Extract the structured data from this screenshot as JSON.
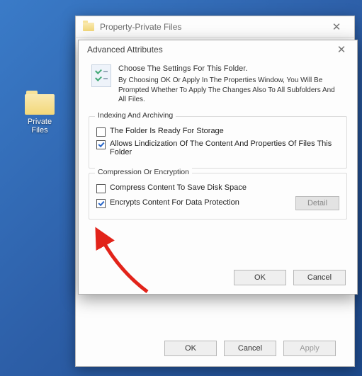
{
  "desktop": {
    "folder_label": "Private Files"
  },
  "props": {
    "title": "Property-Private Files",
    "buttons": {
      "ok": "OK",
      "cancel": "Cancel",
      "apply": "Apply"
    }
  },
  "adv": {
    "title": "Advanced Attributes",
    "header": {
      "line1": "Choose The Settings For This Folder.",
      "line2": "By Choosing OK Or Apply In The Properties Window, You Will Be Prompted Whether To Apply The Changes Also To All Subfolders And All Files."
    },
    "group1": {
      "legend": "Indexing And Archiving",
      "chk1": "The Folder Is Ready For Storage",
      "chk2": "Allows Lindicization Of The Content And Properties Of Files This Folder"
    },
    "group2": {
      "legend": "Compression Or Encryption",
      "chk1": "Compress Content To Save Disk Space",
      "chk2": "Encrypts Content For Data Protection",
      "detail": "Detail"
    },
    "buttons": {
      "ok": "OK",
      "cancel": "Cancel"
    }
  }
}
